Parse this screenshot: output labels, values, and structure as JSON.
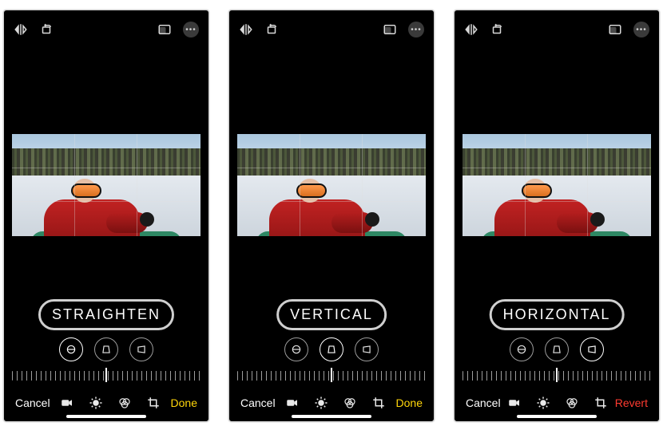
{
  "screens": [
    {
      "top": {
        "flip": "flip-icon",
        "rotate": "rotate-icon",
        "aspect": "aspect-icon",
        "more": "more-icon"
      },
      "callout": "STRAIGHTEN",
      "modes": {
        "straighten_selected": true,
        "vertical_selected": false,
        "horizontal_selected": false
      },
      "bottom": {
        "cancel": "Cancel",
        "done": "Done",
        "done_color": "#ffd60a",
        "crop_active": true
      }
    },
    {
      "top": {
        "flip": "flip-icon",
        "rotate": "rotate-icon",
        "aspect": "aspect-icon",
        "more": "more-icon"
      },
      "callout": "VERTICAL",
      "modes": {
        "straighten_selected": false,
        "vertical_selected": true,
        "horizontal_selected": false
      },
      "bottom": {
        "cancel": "Cancel",
        "done": "Done",
        "done_color": "#ffd60a",
        "crop_active": true
      }
    },
    {
      "top": {
        "flip": "flip-icon",
        "rotate": "rotate-icon",
        "aspect": "aspect-icon",
        "more": "more-icon"
      },
      "callout": "HORIZONTAL",
      "modes": {
        "straighten_selected": false,
        "vertical_selected": false,
        "horizontal_selected": true
      },
      "bottom": {
        "cancel": "Cancel",
        "done": "Revert",
        "done_color": "#ff3b30",
        "crop_active": true
      }
    }
  ],
  "icons": {
    "flip": "flip",
    "rotate": "rotate",
    "aspect": "aspect",
    "more": "more",
    "video": "video",
    "adjust": "adjust",
    "filters": "filters",
    "crop": "crop",
    "straighten": "straighten",
    "vertical": "vertical-perspective",
    "horizontal": "horizontal-perspective"
  }
}
